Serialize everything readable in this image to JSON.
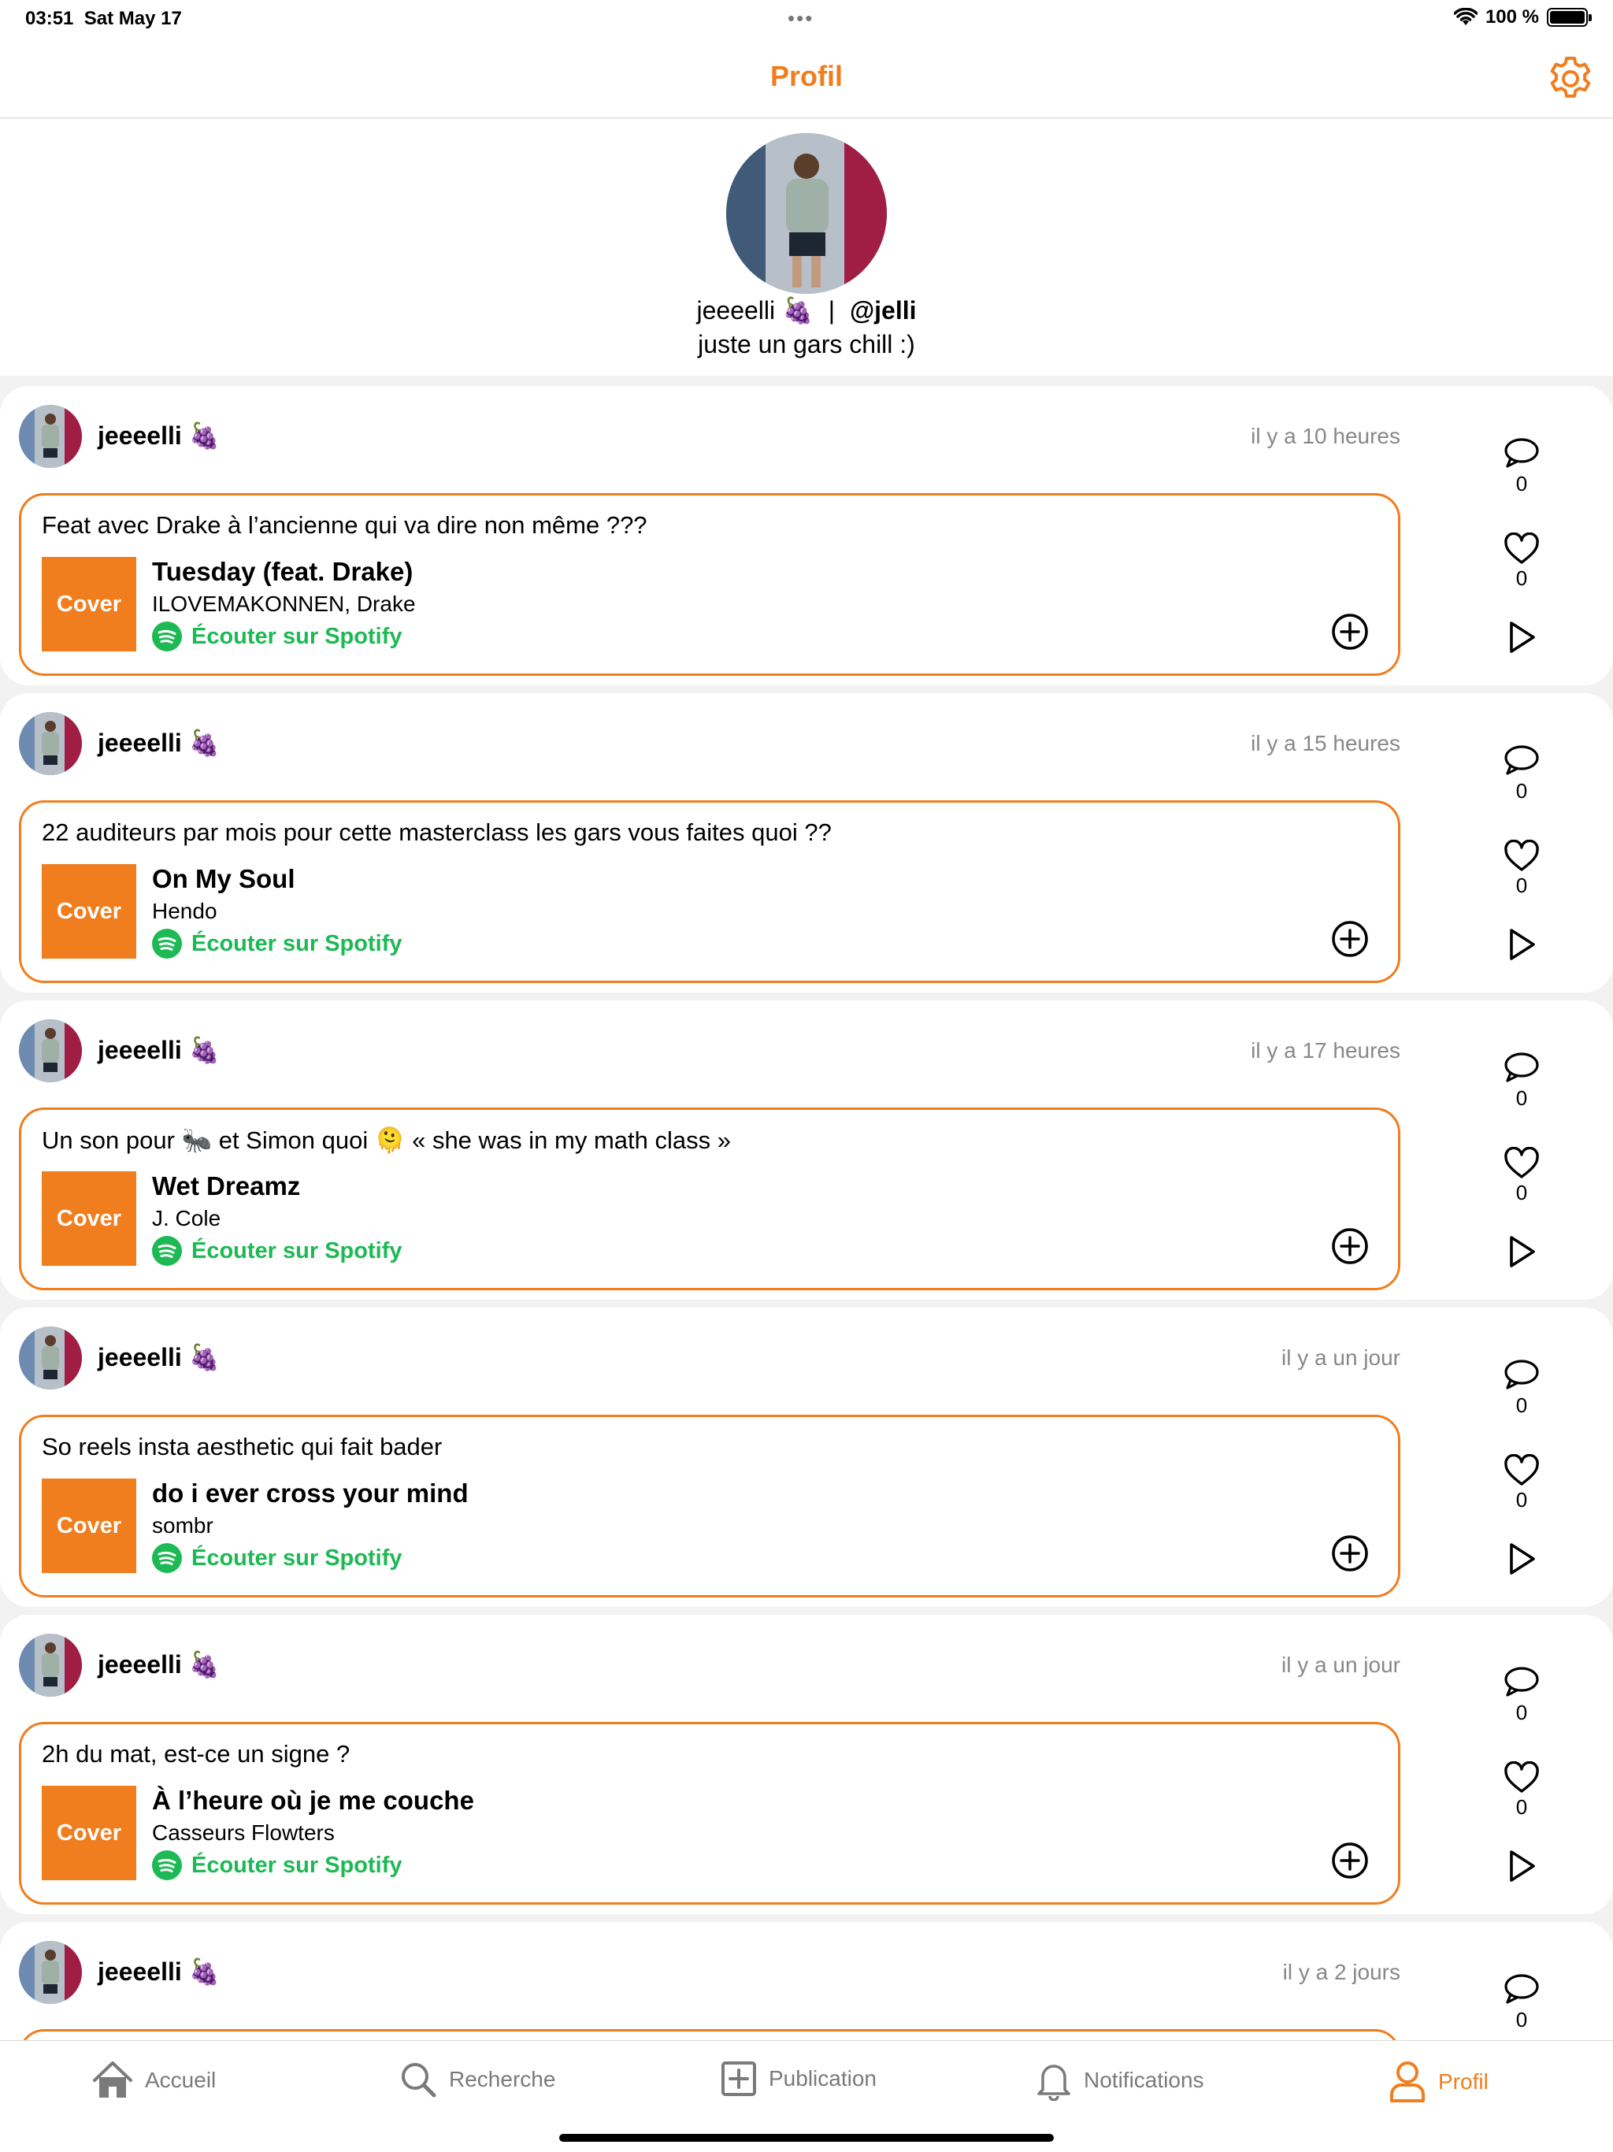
{
  "status": {
    "time": "03:51",
    "date": "Sat May 17",
    "battery": "100 %"
  },
  "nav": {
    "title": "Profil"
  },
  "profile": {
    "name": "jeeeelli 🍇",
    "separator": "|",
    "handle": "@jelli",
    "bio": "juste un gars chill :)"
  },
  "colors": {
    "accent": "#f07d1e",
    "spotify": "#1db954"
  },
  "posts": [
    {
      "user": "jeeeelli 🍇",
      "time": "il y a 10 heures",
      "text": "Feat avec Drake à l’ancienne qui va dire non même ???",
      "cover": "Cover",
      "title": "Tuesday (feat. Drake)",
      "artist": "ILOVEMAKONNEN, Drake",
      "spotify": "Écouter sur Spotify",
      "comments": "0",
      "likes": "0"
    },
    {
      "user": "jeeeelli 🍇",
      "time": "il y a 15 heures",
      "text": "22 auditeurs par mois pour cette masterclass les gars vous faites quoi ??",
      "cover": "Cover",
      "title": "On My Soul",
      "artist": "Hendo",
      "spotify": "Écouter sur Spotify",
      "comments": "0",
      "likes": "0"
    },
    {
      "user": "jeeeelli 🍇",
      "time": "il y a 17 heures",
      "text": "Un son pour 🐜 et Simon quoi 🫠 « she was in my math class »",
      "cover": "Cover",
      "title": "Wet Dreamz",
      "artist": "J. Cole",
      "spotify": "Écouter sur Spotify",
      "comments": "0",
      "likes": "0"
    },
    {
      "user": "jeeeelli 🍇",
      "time": "il y a un jour",
      "text": "So reels insta aesthetic qui fait bader",
      "cover": "Cover",
      "title": "do i ever cross your mind",
      "artist": "sombr",
      "spotify": "Écouter sur Spotify",
      "comments": "0",
      "likes": "0"
    },
    {
      "user": "jeeeelli 🍇",
      "time": "il y a un jour",
      "text": "2h du mat, est-ce un signe ?",
      "cover": "Cover",
      "title": "À l’heure où je me couche",
      "artist": "Casseurs Flowters",
      "spotify": "Écouter sur Spotify",
      "comments": "0",
      "likes": "0"
    },
    {
      "user": "jeeeelli 🍇",
      "time": "il y a 2 jours",
      "text": "",
      "cover": "",
      "title": "",
      "artist": "",
      "spotify": "",
      "comments": "0",
      "likes": ""
    }
  ],
  "tabs": [
    {
      "label": "Accueil",
      "icon": "home-icon",
      "active": false
    },
    {
      "label": "Recherche",
      "icon": "search-icon",
      "active": false
    },
    {
      "label": "Publication",
      "icon": "add-post-icon",
      "active": false
    },
    {
      "label": "Notifications",
      "icon": "bell-icon",
      "active": false
    },
    {
      "label": "Profil",
      "icon": "person-icon",
      "active": true
    }
  ]
}
